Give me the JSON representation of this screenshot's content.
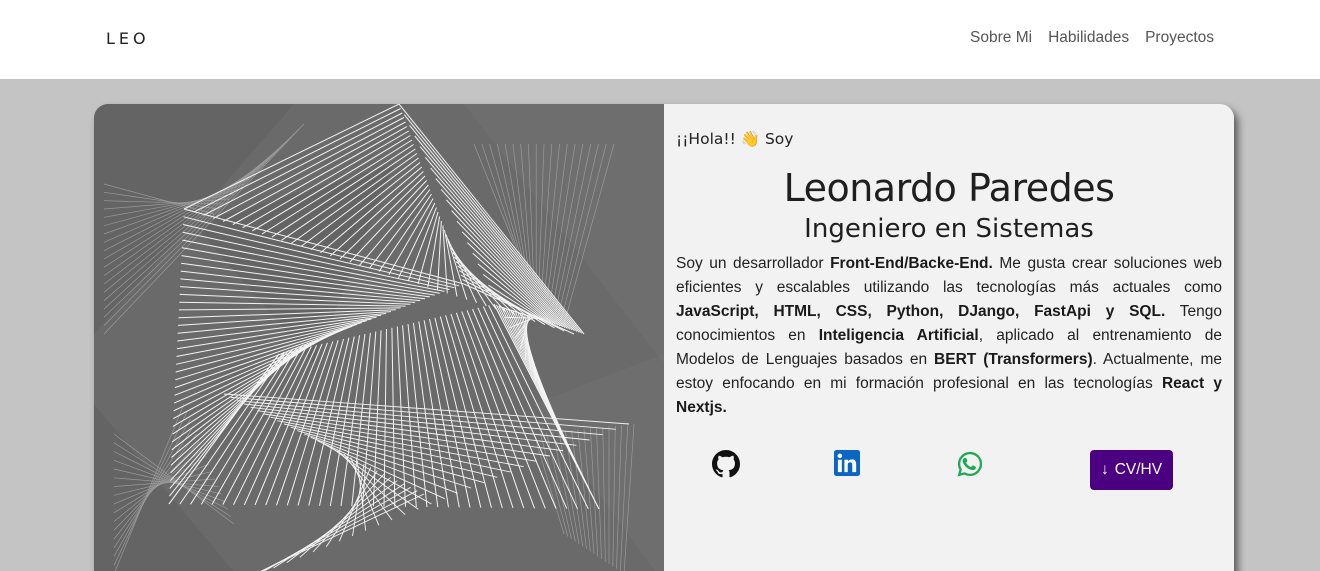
{
  "navbar": {
    "brand": "LEO",
    "links": [
      "Sobre Mi",
      "Habilidades",
      "Proyectos"
    ]
  },
  "hero": {
    "greeting": "¡¡Hola!! 👋 Soy",
    "name": "Leonardo Paredes",
    "title": "Ingeniero en Sistemas",
    "bio": [
      {
        "t": "Soy un desarrollador ",
        "b": false
      },
      {
        "t": "Front-End/Backe-End.",
        "b": true
      },
      {
        "t": " Me gusta crear soluciones web eficientes y escalables utilizando las tecnologías más actuales como ",
        "b": false
      },
      {
        "t": "JavaScript, HTML, CSS, Python, DJango, FastApi y SQL.",
        "b": true
      },
      {
        "t": " Tengo conocimientos en ",
        "b": false
      },
      {
        "t": "Inteligencia Artificial",
        "b": true
      },
      {
        "t": ", aplicado al entrenamiento de Modelos de Lenguajes basados en ",
        "b": false
      },
      {
        "t": "BERT (Transformers)",
        "b": true
      },
      {
        "t": ". Actualmente, me estoy enfocando en mi formación profesional en las tecnologías ",
        "b": false
      },
      {
        "t": "React y Nextjs.",
        "b": true
      }
    ],
    "socials": [
      {
        "icon": "github-icon",
        "color": "#111111"
      },
      {
        "icon": "linkedin-icon",
        "color": "#0a66c2"
      },
      {
        "icon": "whatsapp-icon",
        "color": "#1fa855"
      }
    ],
    "cv_button": {
      "arrow": "↓",
      "label": "CV/HV",
      "color": "#4b0082"
    }
  }
}
